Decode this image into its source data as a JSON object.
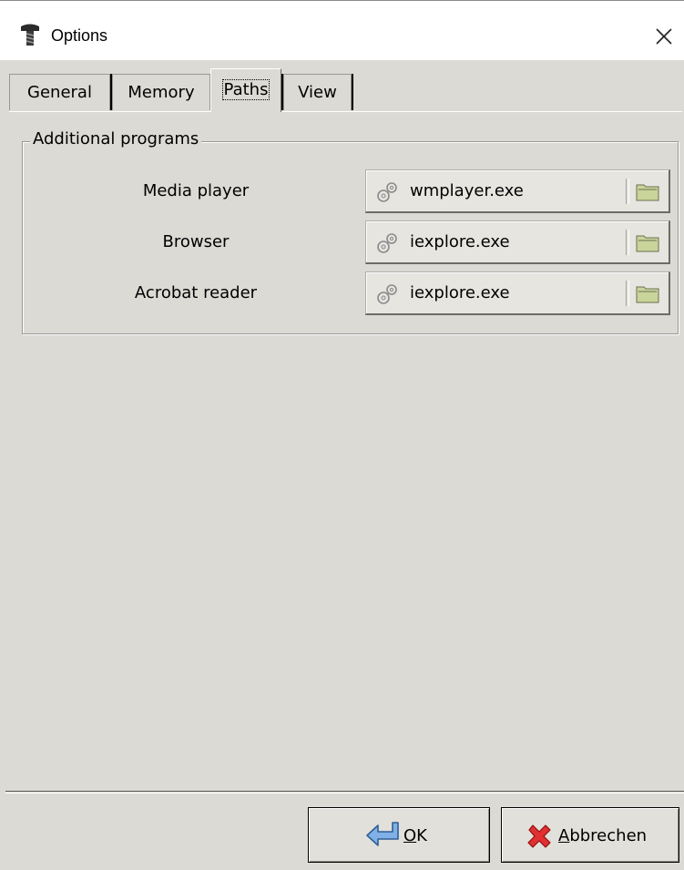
{
  "window": {
    "title": "Options"
  },
  "tabs": [
    {
      "label": "General"
    },
    {
      "label": "Memory"
    },
    {
      "label": "Paths",
      "selected": true
    },
    {
      "label": "View"
    }
  ],
  "group": {
    "legend": "Additional programs",
    "rows": [
      {
        "label": "Media player",
        "value": "wmplayer.exe"
      },
      {
        "label": "Browser",
        "value": "iexplore.exe"
      },
      {
        "label": "Acrobat reader",
        "value": "iexplore.exe"
      }
    ]
  },
  "buttons": {
    "ok": {
      "mnemonic": "O",
      "rest": "K"
    },
    "cancel": {
      "mnemonic": "A",
      "rest": "bbrechen"
    }
  },
  "icons": {
    "title": "screw-icon",
    "close": "close-icon",
    "program": "gear-icon",
    "browse": "folder-icon",
    "ok": "enter-arrow-icon",
    "cancel": "red-x-icon"
  },
  "colors": {
    "dialog_bg": "#dcdad5",
    "titlebar_bg": "#ffffff",
    "folder": "#c9d49a",
    "cancel_x": "#d42020",
    "ok_arrow": "#4f86c6"
  }
}
